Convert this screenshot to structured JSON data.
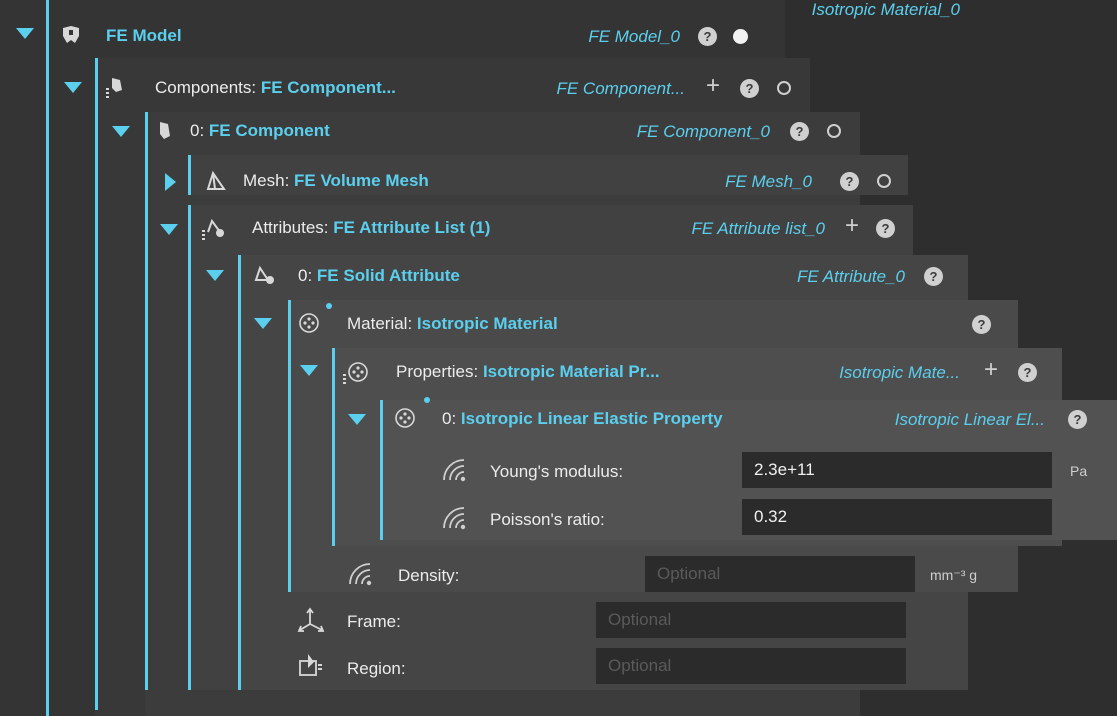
{
  "tree": {
    "fe_model": {
      "label": "FE Model",
      "instance": "FE Model_0"
    },
    "components": {
      "label": "Components:",
      "value": "FE Component...",
      "instance": "FE Component..."
    },
    "component0": {
      "label": "0:",
      "value": "FE Component",
      "instance": "FE Component_0"
    },
    "mesh": {
      "label": "Mesh:",
      "value": "FE Volume Mesh",
      "instance": "FE Mesh_0"
    },
    "attributes": {
      "label": "Attributes:",
      "value": "FE Attribute List (1)",
      "instance": "FE Attribute list_0"
    },
    "attribute0": {
      "label": "0:",
      "value": "FE Solid Attribute",
      "instance": "FE Attribute_0"
    },
    "material": {
      "label": "Material:",
      "value": "Isotropic Material",
      "instance": "Isotropic Material_0"
    },
    "properties": {
      "label": "Properties:",
      "value": "Isotropic Material Pr...",
      "instance": "Isotropic Mate..."
    },
    "property0": {
      "label": "0:",
      "value": "Isotropic Linear Elastic Property",
      "instance": "Isotropic Linear El..."
    }
  },
  "fields": {
    "youngs": {
      "label": "Young's modulus:",
      "value": "2.3e+11",
      "unit": "Pa"
    },
    "poisson": {
      "label": "Poisson's ratio:",
      "value": "0.32"
    },
    "density": {
      "label": "Density:",
      "placeholder": "Optional",
      "unit": "mm⁻³ g"
    },
    "frame": {
      "label": "Frame:",
      "placeholder": "Optional"
    },
    "region": {
      "label": "Region:",
      "placeholder": "Optional"
    }
  },
  "colors": {
    "accent": "#5bcfee",
    "background": "#2e2e2e"
  }
}
